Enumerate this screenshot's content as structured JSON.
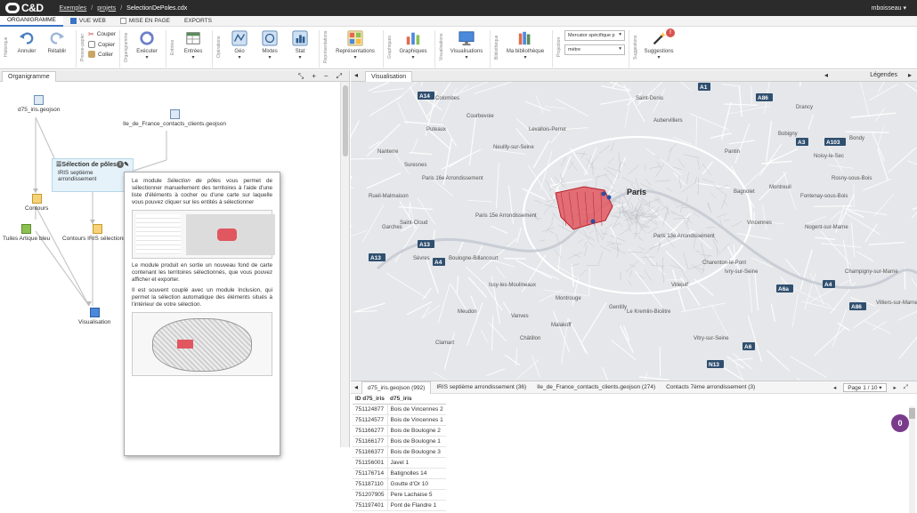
{
  "app": {
    "logo": "C&D",
    "user": "mboisseau",
    "user_caret": "▾"
  },
  "breadcrumb": [
    {
      "label": "Exemples"
    },
    {
      "label": "projets"
    },
    {
      "label": "SelectionDePoles.cdx"
    }
  ],
  "breadcrumb_sep": "/",
  "top_tabs": [
    {
      "label": "ORGANIGRAMME",
      "active": true
    },
    {
      "label": "VUE WEB",
      "checked": true
    },
    {
      "label": "MISE EN PAGE",
      "checked": false
    },
    {
      "label": "EXPORTS"
    }
  ],
  "ribbon": {
    "groups_labels": {
      "historique": "Historique",
      "presse_papier": "Presse-papier",
      "organigramme": "Organigramme",
      "entrees": "Entrées",
      "operations": "Opérations",
      "representations": "Représentations",
      "graphiques": "Graphiques",
      "visualisations": "Visualisations",
      "bibliotheque": "Bibliothèque",
      "projection": "Projection",
      "suggestions": "Suggestions"
    },
    "undo": "Annuler",
    "redo": "Rétablir",
    "cut": "Couper",
    "copy": "Copier",
    "paste": "Coller",
    "execute": "Exécuter",
    "entrees": "Entrées",
    "geo": "Géo",
    "mixtes": "Mixtes",
    "stat": "Stat",
    "representations": "Représentations",
    "graphiques": "Graphiques",
    "visualisations": "Visualisations",
    "bibliotheque": "Ma bibliothèque",
    "projection_value": "Mercator spécifique p",
    "unit_value": "mètre",
    "suggestions": "Suggestions",
    "suggestions_count": "!",
    "caret": "▾"
  },
  "left_panel": {
    "tab": "Organigramme",
    "tools": [
      "⤡",
      "+",
      "−",
      "⤢"
    ],
    "nodes": {
      "d75": "d75_iris.geojson",
      "ile": "Ile_de_France_contacts_clients.geojson",
      "contours": "Contours",
      "tuiles": "Tuiles Artique bleu",
      "contours_iris": "Contours IRIS sélectionnés",
      "visualisation": "Visualisation"
    },
    "selection_box": {
      "title": "Sélection de pôles",
      "info": "i",
      "sub": "IRIS septième arrondissement"
    },
    "tooltip": {
      "p1a": "Le module ",
      "p1em": "Sélection de pôles",
      "p1b": " vous permet de sélectionner manuellement des territoires à l'aide d'une liste d'éléments à cocher ou d'une carte sur laquelle vous pouvez cliquer sur les entités à sélectionner",
      "p2": "Le module produit en sortie un nouveau fond de carte contenant les territoires sélectionnés, que vous pouvez afficher et exporter.",
      "p3": "Il est souvent couplé avec un module Inclusion, qui permet la sélection automatique des éléments situés à l'intérieur de votre sélection."
    }
  },
  "right_panel": {
    "tab": "Visualisation",
    "legend": "Légendes",
    "collapse_left": "◂",
    "collapse_right": "▸",
    "map": {
      "colors": {
        "selection": "#e05760",
        "selection_stroke": "#b8232e",
        "bg": "#e6e7ea",
        "road": "#ffffff",
        "highway_badge": "#2f4f6f"
      },
      "labels": [
        {
          "t": "Paris",
          "big": true
        },
        {
          "t": "Paris 15e Arrondissement"
        },
        {
          "t": "Paris 16e Arrondissement"
        },
        {
          "t": "Paris 13e Arrondissement"
        },
        {
          "t": "Villejuif"
        },
        {
          "t": "Boulogne-Billancourt"
        },
        {
          "t": "Issy-les-Moulineaux"
        },
        {
          "t": "Montrouge"
        },
        {
          "t": "Ivry-sur-Seine"
        },
        {
          "t": "Vincennes"
        },
        {
          "t": "Montreuil"
        },
        {
          "t": "Pantin"
        },
        {
          "t": "Aubervilliers"
        },
        {
          "t": "Nanterre"
        },
        {
          "t": "Suresnes"
        },
        {
          "t": "Rueil-Malmaison"
        },
        {
          "t": "Saint-Cloud"
        },
        {
          "t": "Sèvres"
        },
        {
          "t": "Meudon"
        },
        {
          "t": "Clamart"
        },
        {
          "t": "Garches"
        },
        {
          "t": "Levallois-Perret"
        },
        {
          "t": "Saint-Denis"
        },
        {
          "t": "Bobigny"
        },
        {
          "t": "Bagnolet"
        },
        {
          "t": "Charenton-le-Pont"
        },
        {
          "t": "Nogent-sur-Marne"
        },
        {
          "t": "Fontenay-sous-Bois"
        },
        {
          "t": "Rosny-sous-Bois"
        },
        {
          "t": "Noisy-le-Sec"
        },
        {
          "t": "Vitry-sur-Seine"
        },
        {
          "t": "Châtillon"
        },
        {
          "t": "Vanves"
        },
        {
          "t": "Malakoff"
        },
        {
          "t": "Gentilly"
        },
        {
          "t": "Le Kremlin-Bicêtre"
        },
        {
          "t": "Champigny-sur-Marne"
        },
        {
          "t": "Villiers-sur-Marne"
        },
        {
          "t": "Bondy"
        },
        {
          "t": "Drancy"
        },
        {
          "t": "Neuilly-sur-Seine"
        },
        {
          "t": "Puteaux"
        },
        {
          "t": "Courbevoie"
        },
        {
          "t": "Colombes"
        }
      ],
      "highways": [
        "A14",
        "A86",
        "A1",
        "A3",
        "A103",
        "A13",
        "A4",
        "A6",
        "A6a",
        "A4",
        "N13",
        "A86",
        "A13"
      ]
    },
    "table": {
      "tabs": [
        {
          "label": "d75_iris.geojson (992)",
          "active": true
        },
        {
          "label": "IRIS septième arrondissement (36)"
        },
        {
          "label": "Ile_de_France_contacts_clients.geojson (274)"
        },
        {
          "label": "Contacts 7ème arrondissement (3)"
        }
      ],
      "pager": {
        "prev": "◂",
        "page": "Page 1 / 10",
        "caret": "▾",
        "next": "▸"
      },
      "columns": [
        "ID d75_iris",
        "d75_iris"
      ],
      "rows": [
        [
          "751124877",
          "Bois de Vincennes 2"
        ],
        [
          "751124577",
          "Bois de Vincennes 1"
        ],
        [
          "751166277",
          "Bois de Boulogne 2"
        ],
        [
          "751166177",
          "Bois de Boulogne 1"
        ],
        [
          "751166377",
          "Bois de Boulogne 3"
        ],
        [
          "751156001",
          "Javel 1"
        ],
        [
          "751176714",
          "Batignolles 14"
        ],
        [
          "751187110",
          "Goutte d'Or 10"
        ],
        [
          "751207905",
          "Pere Lachaise 5"
        ],
        [
          "751197401",
          "Pont de Flandre 1"
        ]
      ]
    }
  },
  "fab": "0"
}
